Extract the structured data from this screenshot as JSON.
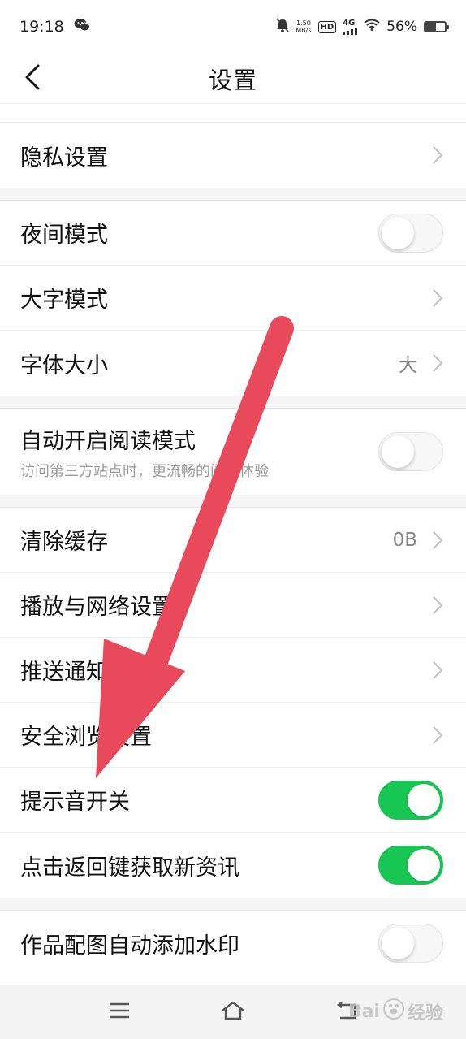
{
  "status_bar": {
    "time": "19:18",
    "net_speed_value": "1.50",
    "net_speed_unit": "MB/s",
    "hd_label": "HD",
    "signal_label": "4G",
    "battery_percent": "56%",
    "battery_level": 0.56
  },
  "header": {
    "back_icon": "chevron-left-icon",
    "title": "设置"
  },
  "sections": [
    {
      "rows": [
        {
          "label": "隐私设置",
          "control": "chevron"
        }
      ]
    },
    {
      "rows": [
        {
          "label": "夜间模式",
          "control": "toggle",
          "on": false
        },
        {
          "label": "大字模式",
          "control": "chevron"
        },
        {
          "label": "字体大小",
          "control": "chevron",
          "value": "大"
        }
      ]
    },
    {
      "rows": [
        {
          "label": "自动开启阅读模式",
          "sub": "访问第三方站点时，更流畅的阅读体验",
          "control": "toggle",
          "on": false
        }
      ]
    },
    {
      "rows": [
        {
          "label": "清除缓存",
          "control": "chevron",
          "value": "0B"
        },
        {
          "label": "播放与网络设置",
          "control": "chevron"
        },
        {
          "label": "推送通知",
          "control": "chevron"
        },
        {
          "label": "安全浏览设置",
          "control": "chevron"
        },
        {
          "label": "提示音开关",
          "control": "toggle",
          "on": true
        },
        {
          "label": "点击返回键获取新资讯",
          "control": "toggle",
          "on": true
        }
      ]
    },
    {
      "rows": [
        {
          "label": "作品配图自动添加水印",
          "control": "toggle",
          "on": false
        }
      ]
    }
  ],
  "system_nav": {
    "menu_icon": "menu-icon",
    "home_icon": "home-icon",
    "back_icon": "return-icon"
  },
  "watermark": {
    "text_a": "Bai",
    "text_b": "经验"
  },
  "colors": {
    "toggle_on": "#17c653",
    "arrow": "#e8495b",
    "chevron": "#c4c4c4"
  }
}
